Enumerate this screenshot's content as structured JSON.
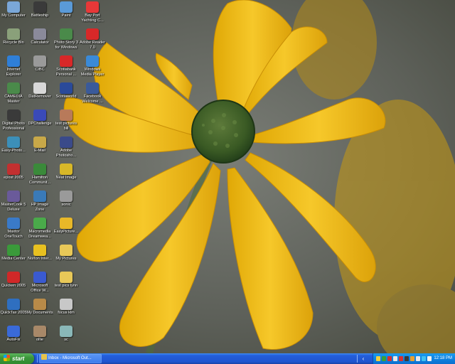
{
  "desktop": {
    "icons": [
      {
        "label": "My Computer",
        "icon": "my-computer-icon",
        "color": "#7aa7d8"
      },
      {
        "label": "Recycle Bin",
        "icon": "recycle-bin-icon",
        "color": "#8aa07a"
      },
      {
        "label": "Internet Explorer",
        "icon": "internet-explorer-icon",
        "color": "#2f7fd8"
      },
      {
        "label": "CAMEDIA Master",
        "icon": "camedia-master-icon",
        "color": "#4a8a4a"
      },
      {
        "label": "Digital Photo Professional",
        "icon": "digital-photo-professional-icon",
        "color": "#3a3a3a"
      },
      {
        "label": "Easy-Photo...",
        "icon": "easy-photo-icon",
        "color": "#3c8fb8"
      },
      {
        "label": "epost 2005",
        "icon": "epost-icon",
        "color": "#c23030"
      },
      {
        "label": "MasterCook 5 Deluxe",
        "icon": "mastercook-icon",
        "color": "#6a5a9a"
      },
      {
        "label": "Maxtor OneTouch",
        "icon": "maxtor-onetouch-icon",
        "color": "#3a7ac8"
      },
      {
        "label": "Media Center",
        "icon": "media-center-icon",
        "color": "#3a9a3a"
      },
      {
        "label": "Quicken 2005",
        "icon": "quicken-icon",
        "color": "#d02828"
      },
      {
        "label": "QuickTax 2005",
        "icon": "quicktax-icon",
        "color": "#2f6fc0"
      },
      {
        "label": "AutoFix",
        "icon": "autofix-icon",
        "color": "#3a6ad8"
      },
      {
        "label": "Battleship",
        "icon": "battleship-icon",
        "color": "#3a3a3a"
      },
      {
        "label": "Calculator",
        "icon": "calculator-icon",
        "color": "#8a8a9a"
      },
      {
        "label": "CIBC",
        "icon": "cibc-icon",
        "color": "#9a9a9a"
      },
      {
        "label": "DatRemover",
        "icon": "datremover-icon",
        "color": "#d8d8d8"
      },
      {
        "label": "DPChallenge",
        "icon": "dpchallenge-icon",
        "color": "#3a4ab8"
      },
      {
        "label": "E-Mail",
        "icon": "email-icon",
        "color": "#c8a848"
      },
      {
        "label": "Hamilton Communit...",
        "icon": "hamilton-community-icon",
        "color": "#3a8a3a"
      },
      {
        "label": "HP Image Zone",
        "icon": "hp-image-zone-icon",
        "color": "#3a7ab8"
      },
      {
        "label": "Macromedia Dreamwea...",
        "icon": "dreamweaver-icon",
        "color": "#4aaa4a"
      },
      {
        "label": "Norton Inter...",
        "icon": "norton-icon",
        "color": "#e8c020"
      },
      {
        "label": "Microsoft Office W...",
        "icon": "office-word-icon",
        "color": "#3a5ad0"
      },
      {
        "label": "My Documents",
        "icon": "my-documents-icon",
        "color": "#b88a48"
      },
      {
        "label": "ollie",
        "icon": "ollie-icon",
        "color": "#a88868"
      },
      {
        "label": "Paint",
        "icon": "paint-icon",
        "color": "#5a9ad8"
      },
      {
        "label": "Photo Story 3 for Windows",
        "icon": "photo-story-icon",
        "color": "#4a8a4a"
      },
      {
        "label": "Scotiabank Personal ...",
        "icon": "scotiabank-icon",
        "color": "#d82828"
      },
      {
        "label": "Scotiaworld",
        "icon": "scotiaworld-icon",
        "color": "#2a4a9a"
      },
      {
        "label": "test pictures bill",
        "icon": "test-pictures-bill-icon",
        "color": "#b87a5a"
      },
      {
        "label": "Adobe Photosho...",
        "icon": "adobe-photoshop-icon",
        "color": "#3a4a8a"
      },
      {
        "label": "Neat Image",
        "icon": "neat-image-icon",
        "color": "#d8b828"
      },
      {
        "label": "sonic",
        "icon": "sonic-icon",
        "color": "#9a9a9a"
      },
      {
        "label": "EasyPicture...",
        "icon": "easypicture-icon",
        "color": "#e8b828"
      },
      {
        "label": "My Pictures",
        "icon": "my-pictures-icon",
        "color": "#e8c858"
      },
      {
        "label": "test pics lynn",
        "icon": "test-pics-lynn-icon",
        "color": "#e8c858"
      },
      {
        "label": "focus klm",
        "icon": "focus-klm-icon",
        "color": "#c8c8c8"
      },
      {
        "label": "sc",
        "icon": "sc-icon",
        "color": "#8ab8b8"
      },
      {
        "label": "Bay Port Yachting C...",
        "icon": "bay-port-yachting-icon",
        "color": "#e83838"
      },
      {
        "label": "Adobe Reader 7.0",
        "icon": "adobe-reader-icon",
        "color": "#d82828"
      },
      {
        "label": "Windows Media Player",
        "icon": "windows-media-player-icon",
        "color": "#3a8ad8"
      },
      {
        "label": "Facebook Welcome ...",
        "icon": "facebook-icon",
        "color": "#3a5a9a"
      }
    ]
  },
  "taskbar": {
    "start_label": "start",
    "tasks": [
      {
        "label": "Inbox - Microsoft Out..."
      }
    ],
    "clock": "12:18 PM",
    "tray_icons": [
      "#f0d040",
      "#3aa03a",
      "#d83030",
      "#e8e8e8",
      "#d83030",
      "#3a3a3a",
      "#e8a030",
      "#e8e8e8",
      "#40c0f0",
      "#f0f0f0"
    ]
  }
}
